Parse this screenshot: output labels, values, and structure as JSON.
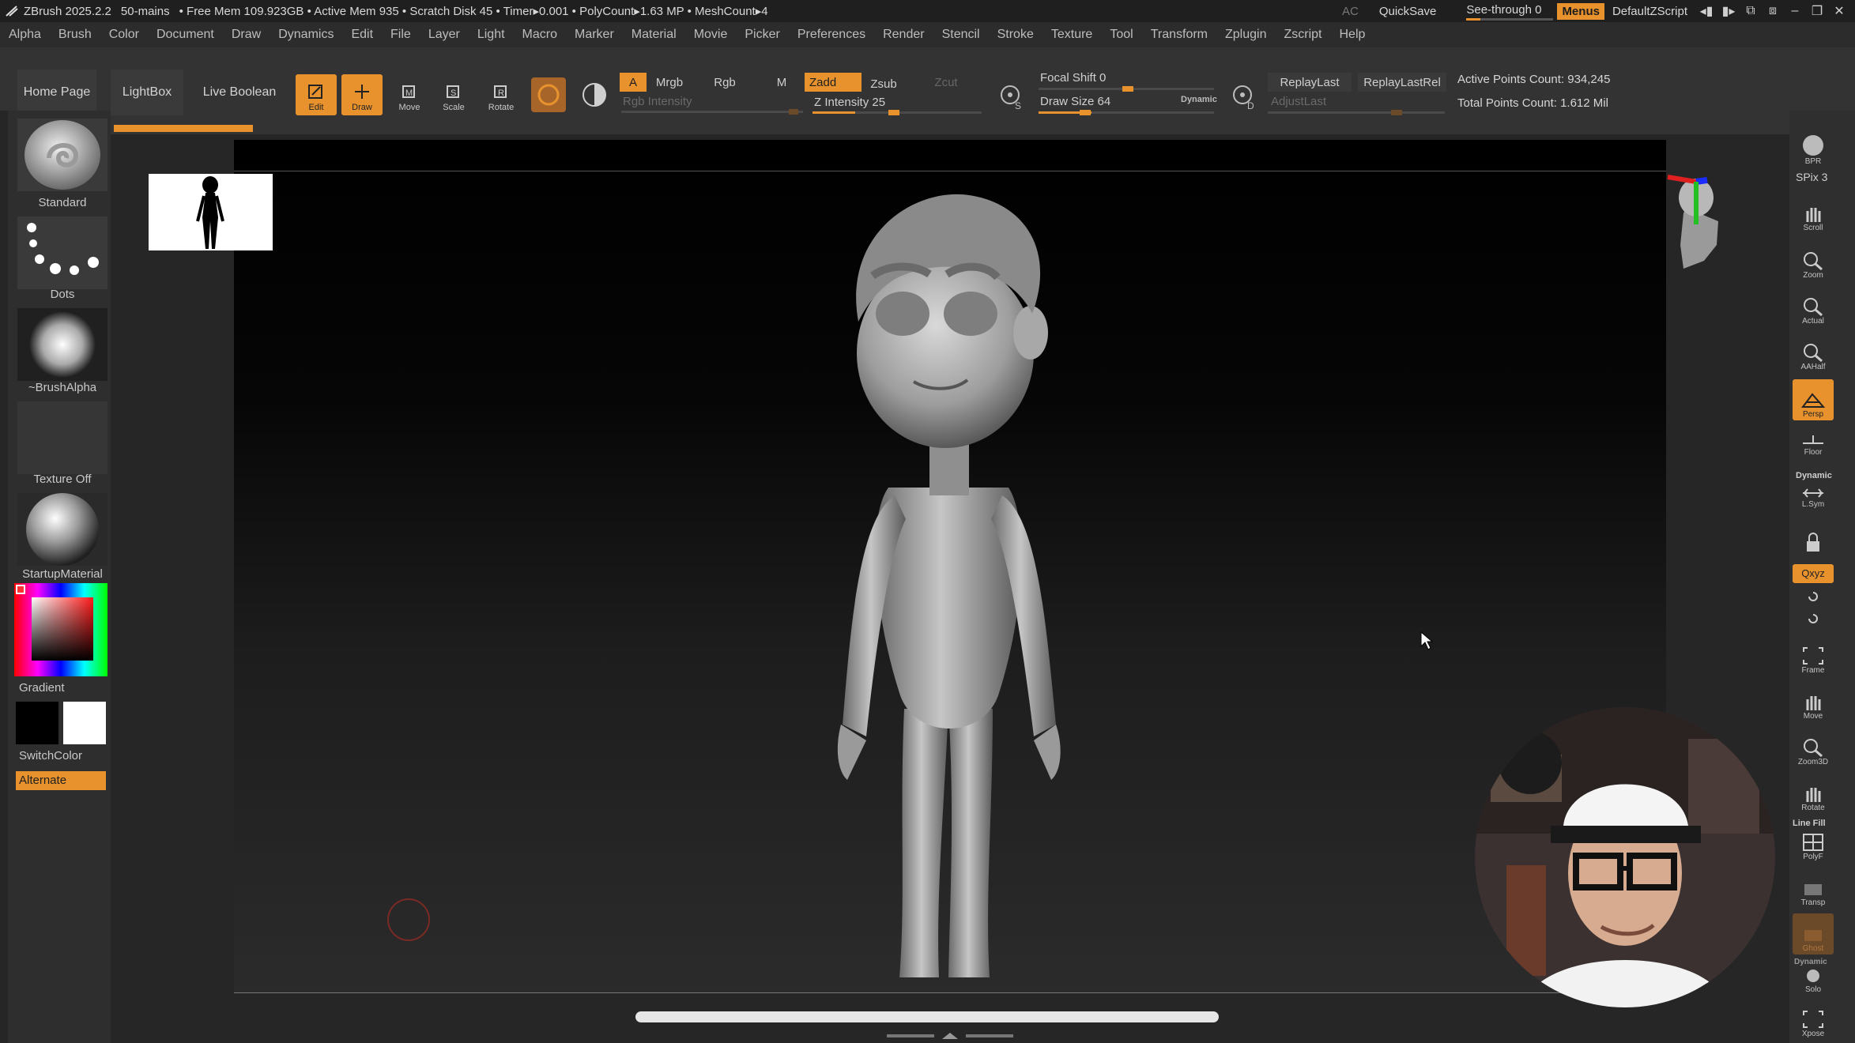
{
  "titlebar": {
    "segments": [
      "ZBrush 2025.2.2",
      "50-mains",
      "• Free Mem 109.923GB • Active Mem 935 • Scratch Disk 45 • Timer▸0.001 • PolyCount▸1.63 MP • MeshCount▸4"
    ],
    "ac": "AC",
    "quicksave": "QuickSave",
    "see_through": "See-through  0",
    "see_through_level": 0,
    "menus": "Menus",
    "default_script": "DefaultZScript"
  },
  "menubar": [
    "Alpha",
    "Brush",
    "Color",
    "Document",
    "Draw",
    "Dynamics",
    "Edit",
    "File",
    "Layer",
    "Light",
    "Macro",
    "Marker",
    "Material",
    "Movie",
    "Picker",
    "Preferences",
    "Render",
    "Stencil",
    "Stroke",
    "Texture",
    "Tool",
    "Transform",
    "Zplugin",
    "Zscript",
    "Help"
  ],
  "nav": {
    "home": "Home Page",
    "lightbox": "LightBox",
    "live_boolean": "Live Boolean"
  },
  "tools": {
    "edit": "Edit",
    "draw": "Draw",
    "move": "Move",
    "scale": "Scale",
    "rotate": "Rotate"
  },
  "modes": {
    "a": "A",
    "mrgb": "Mrgb",
    "rgb": "Rgb",
    "m": "M",
    "zadd": "Zadd",
    "zsub": "Zsub",
    "zcut": "Zcut"
  },
  "sliders": {
    "rgb_intensity": "Rgb Intensity",
    "z_intensity": "Z Intensity 25",
    "focal_shift": "Focal Shift 0",
    "draw_size": "Draw Size 64",
    "dynamic": "Dynamic",
    "adjust_last": "AdjustLast"
  },
  "replay": {
    "last": "ReplayLast",
    "last_rel": "ReplayLastRel"
  },
  "stats": {
    "active_points": "Active Points Count: 934,245",
    "total_points": "Total Points Count: 1.612 Mil"
  },
  "leftpanel": {
    "brush": "Standard",
    "stroke": "Dots",
    "alpha": "~BrushAlpha",
    "texture": "Texture Off",
    "material": "StartupMaterial",
    "gradient": "Gradient",
    "switch_color": "SwitchColor",
    "alternate": "Alternate"
  },
  "rightpanel": {
    "bpr": "BPR",
    "spix": "SPix 3",
    "scroll": "Scroll",
    "zoom": "Zoom",
    "actual": "Actual",
    "aahalf": "AAHalf",
    "persp": "Persp",
    "floor": "Floor",
    "dynamic": "Dynamic",
    "lsym": "L.Sym",
    "xyz": "Qxyz",
    "frame": "Frame",
    "move": "Move",
    "zoom3d": "Zoom3D",
    "rotate": "Rotate",
    "line_fill": "Line Fill",
    "polyf": "PolyF",
    "transp": "Transp",
    "ghost": "Ghost",
    "solo_dynamic": "Dynamic",
    "solo": "Solo",
    "xpose": "Xpose"
  },
  "colors": {
    "accent": "#e8922e",
    "background": "#2b2b2b",
    "canvas_top": "#000000"
  }
}
